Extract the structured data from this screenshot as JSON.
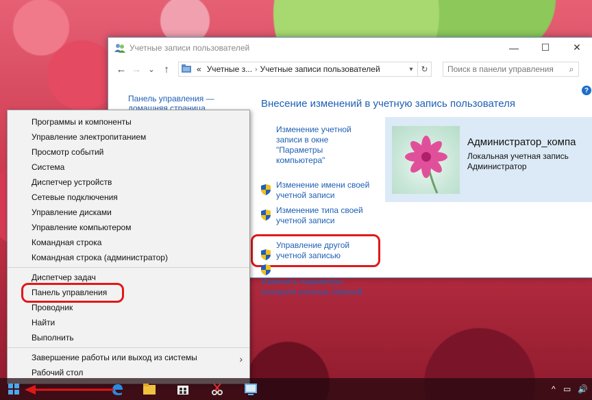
{
  "window": {
    "title": "Учетные записи пользователей",
    "controls": {
      "minimize": "—",
      "maximize": "☐",
      "close": "✕"
    }
  },
  "navbar": {
    "back": "←",
    "forward": "→",
    "recent": "⌄",
    "up": "↑",
    "crumbs": [
      "«",
      "Учетные з...",
      "›",
      "Учетные записи пользователей"
    ],
    "search_placeholder": "Поиск в панели управления"
  },
  "sidebar": {
    "home_link_line1": "Панель управления —",
    "home_link_line2": "домашняя страница"
  },
  "main": {
    "heading": "Внесение изменений в учетную запись пользователя",
    "tasks": [
      {
        "lines": [
          "Изменение учетной",
          "записи в окне",
          "\"Параметры",
          "компьютера\""
        ]
      },
      {
        "lines": [
          "Изменение имени своей",
          "учетной записи"
        ]
      },
      {
        "lines": [
          "Изменение типа своей",
          "учетной записи"
        ]
      },
      {
        "lines": [
          "Управление другой",
          "учетной записью"
        ]
      },
      {
        "lines": [
          "Изменить параметры",
          "контроля учетных записей"
        ]
      }
    ]
  },
  "user": {
    "name": "Администратор_компа",
    "account_type": "Локальная учетная запись",
    "role": "Администратор"
  },
  "context_menu": {
    "items": [
      "Программы и компоненты",
      "Управление электропитанием",
      "Просмотр событий",
      "Система",
      "Диспетчер устройств",
      "Сетевые подключения",
      "Управление дисками",
      "Управление компьютером",
      "Командная строка",
      "Командная строка (администратор)",
      "Диспетчер задач",
      "Панель управления",
      "Проводник",
      "Найти",
      "Выполнить",
      "Завершение работы или выход из системы",
      "Рабочий стол"
    ],
    "highlighted": "Панель управления"
  },
  "colors": {
    "link": "#1e5fb4",
    "highlight_outline": "#e01818",
    "card_bg": "#dbeaf6"
  },
  "taskbar": {
    "icons": [
      "windows-start-icon",
      "edge-icon",
      "file-explorer-icon",
      "store-icon",
      "snipping-tool-icon",
      "control-panel-icon"
    ],
    "tray": {
      "chevron": "^",
      "network": "▭",
      "volume": "🔊"
    }
  }
}
